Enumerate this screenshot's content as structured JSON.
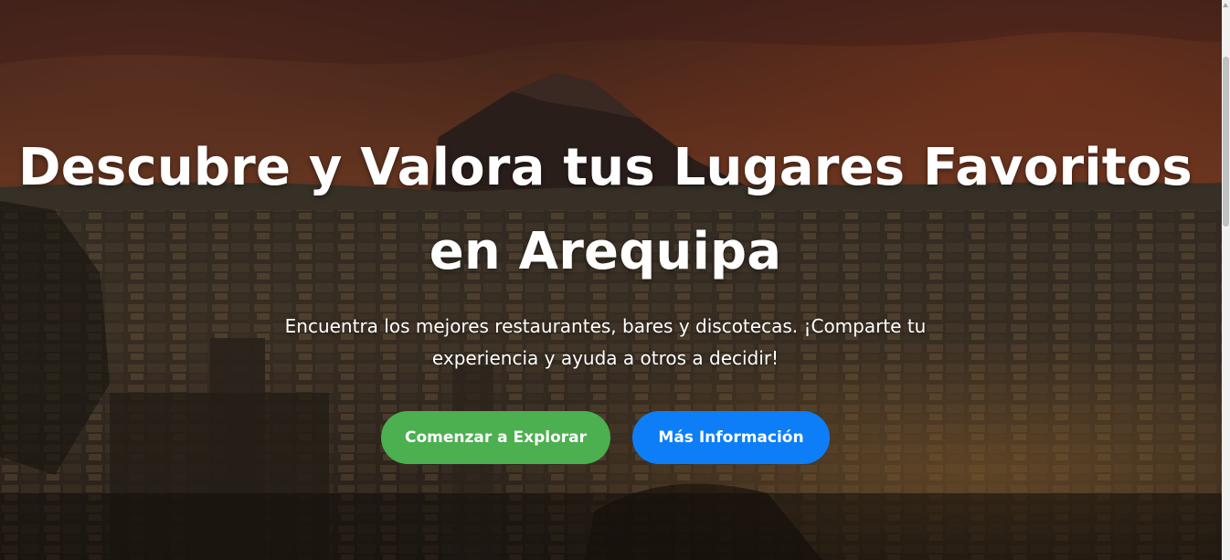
{
  "hero": {
    "title": "Descubre y Valora tus Lugares Favoritos en Arequipa",
    "subtitle": "Encuentra los mejores restaurantes, bares y discotecas. ¡Comparte tu experiencia y ayuda a otros a decidir!",
    "primary_button": "Comenzar a Explorar",
    "secondary_button": "Más Información"
  },
  "colors": {
    "primary_button": "#4CAF50",
    "secondary_button": "#0D7EF7",
    "text": "#FFFFFF"
  },
  "icons": {
    "scroll_up": "triangle-up-icon"
  }
}
